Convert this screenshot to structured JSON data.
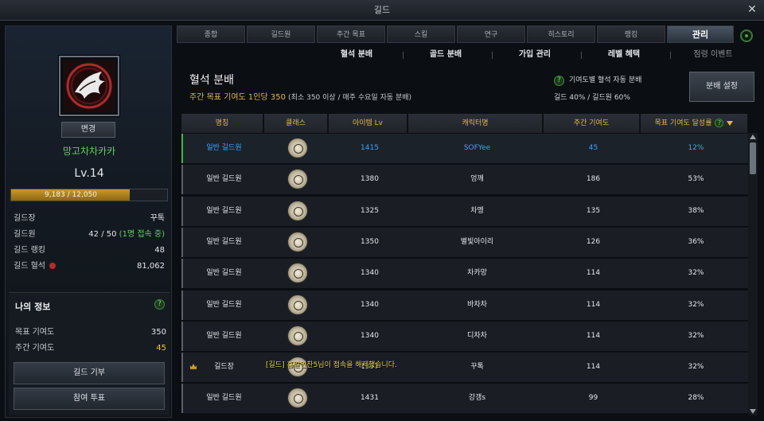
{
  "window": {
    "title": "길드"
  },
  "left": {
    "change_label": "변경",
    "guild_name": "망고차차카카",
    "level": "Lv.14",
    "exp_text": "9,183 / 12,050",
    "exp_fraction": 0.762,
    "stats": [
      {
        "key": "길드장",
        "value": "꾸톡"
      },
      {
        "key": "길드원",
        "value": "42 / 50",
        "extra": "(1명 접속 중)"
      },
      {
        "key": "길드 랭킹",
        "value": "48"
      },
      {
        "key": "길드 혈석",
        "value": "81,062"
      }
    ],
    "my_info": {
      "title": "나의 정보",
      "rows": [
        {
          "key": "목표 기여도",
          "value": "350"
        },
        {
          "key": "주간 기여도",
          "value": "45"
        }
      ],
      "buttons": [
        "길드 기부",
        "참여 투표"
      ]
    }
  },
  "tabs": [
    "종합",
    "길드원",
    "주간 목표",
    "스킬",
    "연구",
    "히스토리",
    "랭킹",
    "관리"
  ],
  "subtabs": [
    "혈석 분배",
    "골드 분배",
    "가입 관리",
    "레벨 혜택",
    "점령 이벤트"
  ],
  "header": {
    "title": "혈석 분배",
    "subtitle": "주간 목표 기여도 1인당 350",
    "subtitle_note": "(최소 350 이상 / 매주 수요일 자동 분배)",
    "auto_label": "기여도별 혈석 자동 분배",
    "ratio": "길드 40% / 길드원 60%",
    "distribute_button": "분배 설정"
  },
  "table": {
    "columns": [
      "명칭",
      "클래스",
      "아이템 Lv",
      "캐릭터명",
      "주간 기여도",
      "목표 기여도 달성률"
    ],
    "rows": [
      {
        "rank": "일반 길드원",
        "class_icon": "class-icon-lyre",
        "item_lv": "1415",
        "name": "SOFYee",
        "weekly": "45",
        "rate": "12%",
        "selected": true
      },
      {
        "rank": "일반 길드원",
        "class_icon": "class-icon-sun",
        "item_lv": "1380",
        "name": "엉깨",
        "weekly": "186",
        "rate": "53%"
      },
      {
        "rank": "일반 길드원",
        "class_icon": "class-icon-wolf",
        "item_lv": "1325",
        "name": "차멩",
        "weekly": "135",
        "rate": "38%"
      },
      {
        "rank": "일반 길드원",
        "class_icon": "class-icon-sun",
        "item_lv": "1350",
        "name": "별빛아이리",
        "weekly": "126",
        "rate": "36%"
      },
      {
        "rank": "일반 길드원",
        "class_icon": "class-icon-wolf",
        "item_lv": "1340",
        "name": "차카망",
        "weekly": "114",
        "rate": "32%"
      },
      {
        "rank": "일반 길드원",
        "class_icon": "class-icon-lyre",
        "item_lv": "1340",
        "name": "바차차",
        "weekly": "114",
        "rate": "32%"
      },
      {
        "rank": "일반 길드원",
        "class_icon": "class-icon-tree",
        "item_lv": "1340",
        "name": "디차차",
        "weekly": "114",
        "rate": "32%"
      },
      {
        "rank": "길드장",
        "class_icon": "class-icon-wolf",
        "item_lv": "1357",
        "name": "꾸톡",
        "weekly": "114",
        "rate": "32%",
        "crown": true
      },
      {
        "rank": "일반 길드원",
        "class_icon": "class-icon-sun",
        "item_lv": "1431",
        "name": "강갱s",
        "weekly": "99",
        "rate": "28%"
      }
    ]
  },
  "toast": "[길드] 흥말인찬5님이 접속을 해제했습니다."
}
